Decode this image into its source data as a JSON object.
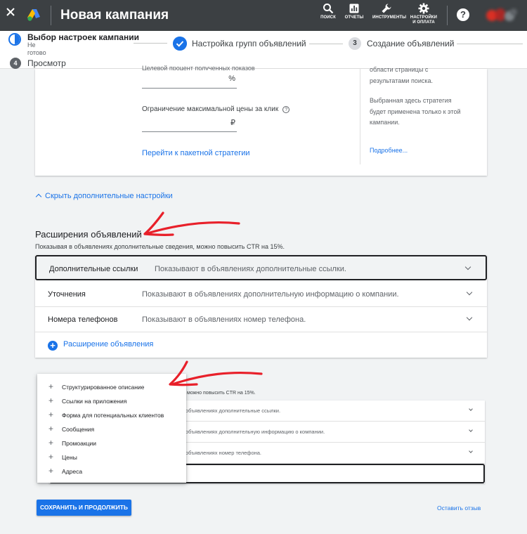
{
  "header": {
    "title": "Новая кампания",
    "tools": {
      "search": "ПОИСК",
      "reports": "ОТЧЕТЫ",
      "tools": "ИНСТРУМЕНТЫ",
      "settings_line1": "НАСТРОЙКИ",
      "settings_line2": "И ОПЛАТА"
    },
    "help": "?"
  },
  "stepper": {
    "step1": {
      "title": "Выбор настроек кампании",
      "status": "Не готово"
    },
    "step2": {
      "title": "Настройка групп объявлений"
    },
    "step3": {
      "number": "3",
      "title": "Создание объявлений"
    },
    "step4": {
      "number": "4",
      "title": "Просмотр"
    }
  },
  "bidding": {
    "target_label_cut": "Целевой процент полученных показов",
    "target_suffix": "%",
    "max_cpc_label": "Ограничение максимальной цены за клик",
    "max_cpc_suffix": "₽",
    "portfolio_link": "Перейти к пакетной стратегии",
    "side_text_1": "области страницы с результатами поиска.",
    "side_text_2": "Выбранная здесь стратегия будет применена только к этой кампании.",
    "side_more": "Подробнее..."
  },
  "hide_advanced": "Скрыть дополнительные настройки",
  "extensions": {
    "title": "Расширения объявлений",
    "subtitle": "Показывая в объявлениях дополнительные сведения, можно повысить CTR на 15%.",
    "rows": [
      {
        "name": "Дополнительные ссылки",
        "desc": "Показывают в объявлениях дополнительные ссылки."
      },
      {
        "name": "Уточнения",
        "desc": "Показывают в объявлениях дополнительную информацию о компании."
      },
      {
        "name": "Номера телефонов",
        "desc": "Показывают в объявлениях номер телефона."
      }
    ],
    "add_label": "Расширение объявления",
    "plus": "+"
  },
  "small_copy": {
    "subtitle": "можно повысить CTR на 15%.",
    "rows": [
      "объявлениях дополнительные ссылки.",
      "объявлениях дополнительную информацию о компании.",
      "объявлениях номер телефона."
    ]
  },
  "menu": {
    "items": [
      "Структурированное описание",
      "Ссылки на приложения",
      "Форма для потенциальных клиентов",
      "Сообщения",
      "Промоакции",
      "Цены",
      "Адреса"
    ]
  },
  "footer": {
    "save": "СОХРАНИТЬ И ПРОДОЛЖИТЬ",
    "feedback": "Оставить отзыв"
  },
  "colors": {
    "topbar": "#3c4043",
    "accent": "#1a73e8",
    "annotation": "#e8202a"
  }
}
